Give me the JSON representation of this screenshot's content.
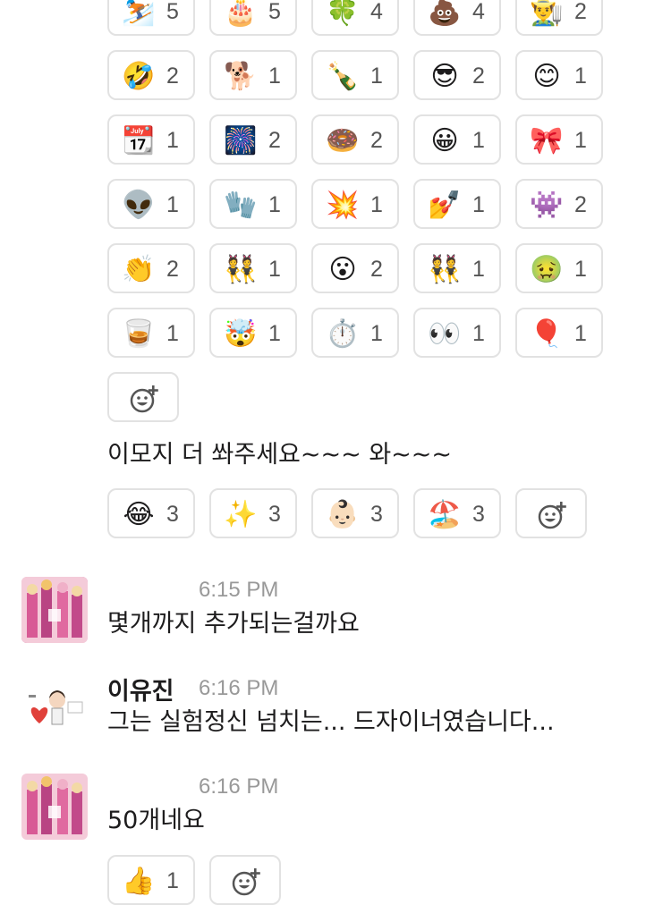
{
  "reactions_grid": [
    {
      "emoji": "⛷️",
      "icon": "skier-icon",
      "count": "5"
    },
    {
      "emoji": "🎂",
      "icon": "cake-icon",
      "count": "5"
    },
    {
      "emoji": "🍀",
      "icon": "four-leaf-clover-icon",
      "count": "4"
    },
    {
      "emoji": "💩",
      "icon": "poop-icon",
      "count": "4"
    },
    {
      "emoji": "👨‍🌾",
      "icon": "farmer-icon",
      "count": "2"
    },
    {
      "emoji": "🤣",
      "icon": "rofl-icon",
      "count": "2"
    },
    {
      "emoji": "🐕",
      "icon": "doge-icon",
      "count": "1"
    },
    {
      "emoji": "🍾",
      "icon": "champagne-icon",
      "count": "1"
    },
    {
      "emoji": "😎",
      "icon": "sunglasses-face-icon",
      "count": "2"
    },
    {
      "emoji": "😊",
      "icon": "blush-icon",
      "count": "1"
    },
    {
      "emoji": "📆",
      "icon": "calendar-icon",
      "count": "1"
    },
    {
      "emoji": "🎆",
      "icon": "fireworks-icon",
      "count": "2"
    },
    {
      "emoji": "🍩",
      "icon": "doughnut-icon",
      "count": "2"
    },
    {
      "emoji": "😀",
      "icon": "grinning-icon",
      "count": "1"
    },
    {
      "emoji": "🎀",
      "icon": "ribbon-icon",
      "count": "1"
    },
    {
      "emoji": "👽",
      "icon": "alien-icon",
      "count": "1"
    },
    {
      "emoji": "🧤",
      "icon": "gloves-icon",
      "count": "1"
    },
    {
      "emoji": "💥",
      "icon": "collision-icon",
      "count": "1"
    },
    {
      "emoji": "💅",
      "icon": "nail-polish-icon",
      "count": "1"
    },
    {
      "emoji": "👾",
      "icon": "space-invader-icon",
      "count": "2"
    },
    {
      "emoji": "👏",
      "icon": "clap-icon",
      "count": "2"
    },
    {
      "emoji": "👯",
      "icon": "dancers-icon",
      "count": "1"
    },
    {
      "emoji": "😮",
      "icon": "open-mouth-icon",
      "count": "2"
    },
    {
      "emoji": "👯",
      "icon": "dancers-icon",
      "count": "1"
    },
    {
      "emoji": "🤢",
      "icon": "nauseated-icon",
      "count": "1"
    },
    {
      "emoji": "🥃",
      "icon": "tumbler-glass-icon",
      "count": "1"
    },
    {
      "emoji": "🤯",
      "icon": "exploding-head-icon",
      "count": "1"
    },
    {
      "emoji": "⏱️",
      "icon": "stopwatch-icon",
      "count": "1"
    },
    {
      "emoji": "👀",
      "icon": "eyes-icon",
      "count": "1"
    },
    {
      "emoji": "🎈",
      "icon": "balloon-icon",
      "count": "1"
    }
  ],
  "message1": {
    "text": "이모지 더 쏴주세요~~~ 와~~~",
    "reactions": [
      {
        "emoji": "😂",
        "icon": "joy-icon",
        "count": "3"
      },
      {
        "emoji": "✨",
        "icon": "sparkles-icon",
        "count": "3"
      },
      {
        "emoji": "👶🏻",
        "icon": "baby-icon",
        "count": "3"
      },
      {
        "emoji": "🏖️",
        "icon": "beach-icon",
        "count": "3"
      }
    ]
  },
  "message2": {
    "time": "6:15 PM",
    "text": "몇개까지 추가되는걸까요"
  },
  "message3": {
    "author": "이유진",
    "time": "6:16 PM",
    "text": "그는 실험정신 넘치는... 드자이너였습니다..."
  },
  "message4": {
    "time": "6:16 PM",
    "text": "50개네요",
    "reactions": [
      {
        "emoji": "👍",
        "icon": "thumbs-up-icon",
        "count": "1"
      }
    ]
  },
  "colors": {
    "pill_border": "#e2e2e2",
    "timestamp": "#999999",
    "text": "#1d1c1d"
  }
}
